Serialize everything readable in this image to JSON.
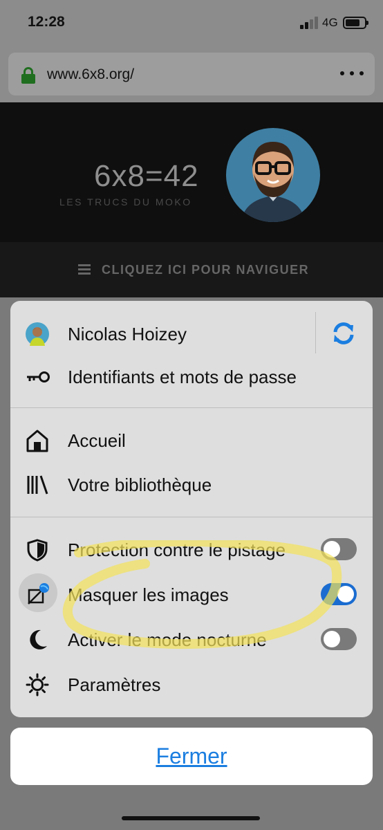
{
  "status": {
    "time": "12:28",
    "network": "4G"
  },
  "browser": {
    "url": "www.6x8.org/"
  },
  "site": {
    "title": "6x8=42",
    "subtitle": "LES TRUCS DU MOKO",
    "nav_label": "CLIQUEZ ICI POUR NAVIGUER"
  },
  "menu": {
    "account_name": "Nicolas Hoizey",
    "logins_label": "Identifiants et mots de passe",
    "home_label": "Accueil",
    "library_label": "Votre bibliothèque",
    "tracking_label": "Protection contre le pistage",
    "tracking_on": false,
    "hide_images_label": "Masquer les images",
    "hide_images_on": true,
    "night_mode_label": "Activer le mode nocturne",
    "night_mode_on": false,
    "settings_label": "Paramètres"
  },
  "close_label": "Fermer",
  "colors": {
    "accent": "#1b7ee0",
    "highlight": "#f3e35a",
    "lock": "#1f6e1f"
  }
}
